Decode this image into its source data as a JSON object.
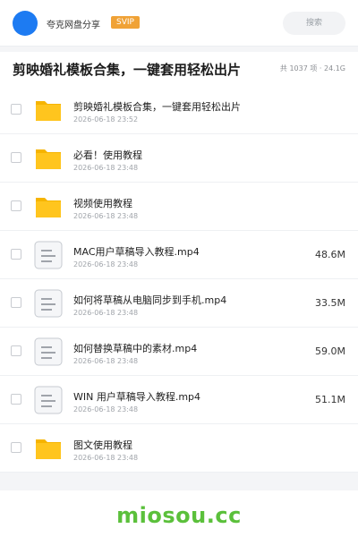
{
  "header": {
    "username": "夸克网盘分享",
    "badge": "SVIP",
    "search_label": "搜索"
  },
  "share": {
    "title": "剪映婚礼模板合集，一键套用轻松出片",
    "meta": "共 1037 项 · 24.1G"
  },
  "files": [
    {
      "name": "剪映婚礼模板合集，一键套用轻松出片",
      "date": "2026-06-18 23:52",
      "size": "",
      "type": "folder"
    },
    {
      "name": "必看！使用教程",
      "date": "2026-06-18 23:48",
      "size": "",
      "type": "folder"
    },
    {
      "name": "视频使用教程",
      "date": "2026-06-18 23:48",
      "size": "",
      "type": "folder"
    },
    {
      "name": "MAC用户草稿导入教程.mp4",
      "date": "2026-06-18 23:48",
      "size": "48.6M",
      "type": "file"
    },
    {
      "name": "如何将草稿从电脑同步到手机.mp4",
      "date": "2026-06-18 23:48",
      "size": "33.5M",
      "type": "file"
    },
    {
      "name": "如何替换草稿中的素材.mp4",
      "date": "2026-06-18 23:48",
      "size": "59.0M",
      "type": "file"
    },
    {
      "name": "WIN 用户草稿导入教程.mp4",
      "date": "2026-06-18 23:48",
      "size": "51.1M",
      "type": "file"
    },
    {
      "name": "图文使用教程",
      "date": "2026-06-18 23:48",
      "size": "",
      "type": "folder"
    }
  ],
  "watermark": "miosou.cc",
  "colors": {
    "accent": "#1d7bf2",
    "svip": "#f0a236",
    "folder": "#ffc51e",
    "watermark": "#5bc03b"
  }
}
